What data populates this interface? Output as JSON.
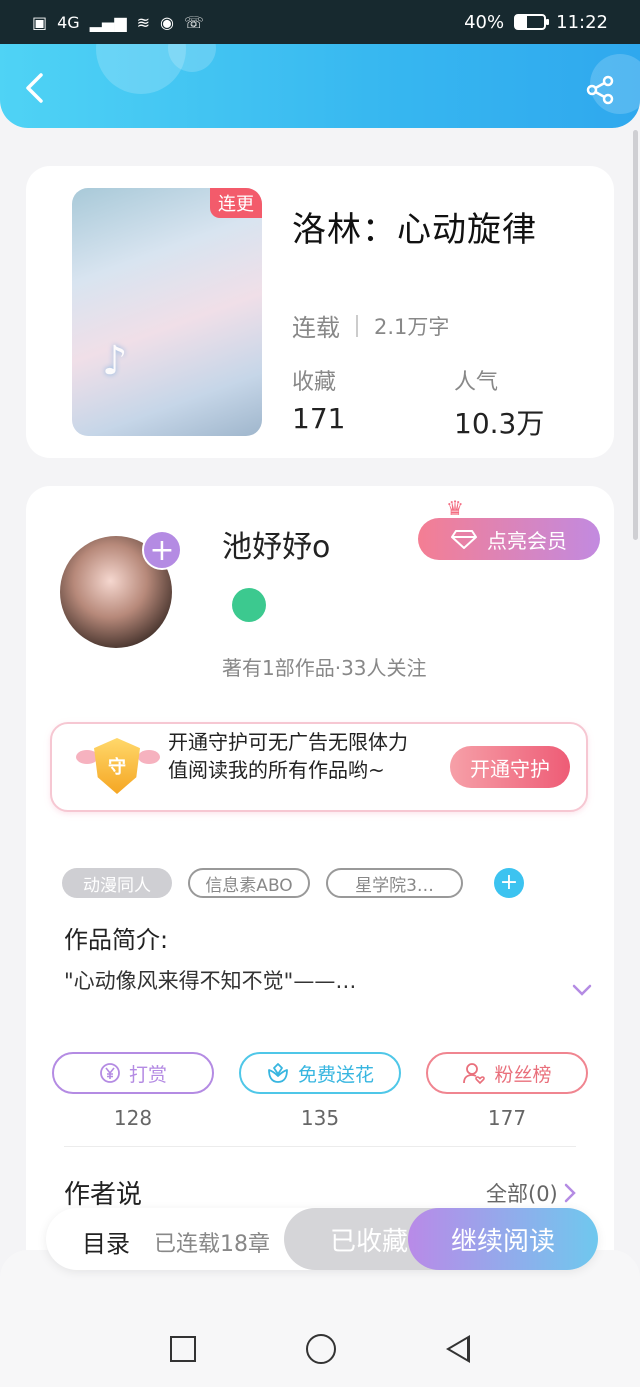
{
  "status_bar": {
    "network": "4G",
    "battery": "40%",
    "battery_level": 0.4,
    "time": "11:22"
  },
  "book": {
    "cover_tag": "连更",
    "title": "洛林：心动旋律",
    "status": "连载",
    "word_count": "2.1万字",
    "favorites_label": "收藏",
    "favorites_value": "171",
    "popularity_label": "人气",
    "popularity_value": "10.3万"
  },
  "author": {
    "name": "池妤妤o",
    "meta": "著有1部作品·33人关注",
    "vip_button": "点亮会员"
  },
  "guard": {
    "shield_text": "守",
    "text": "开通守护可无广告无限体力值阅读我的所有作品哟~",
    "button": "开通守护"
  },
  "tags": [
    "动漫同人",
    "信息素ABO",
    "星学院3…"
  ],
  "intro": {
    "title": "作品简介:",
    "text": "\"心动像风来得不知不觉\"——…"
  },
  "actions": [
    {
      "label": "打赏",
      "count": "128",
      "color": "#b48be3"
    },
    {
      "label": "免费送花",
      "count": "135",
      "color": "#4fc7e8"
    },
    {
      "label": "粉丝榜",
      "count": "177",
      "color": "#f08590"
    }
  ],
  "author_says": {
    "title": "作者说",
    "all_link": "全部(0)"
  },
  "bottom_bar": {
    "toc": "目录",
    "chapters": "已连载18章",
    "collected": "已收藏",
    "continue_reading": "继续阅读"
  },
  "colors": {
    "header": "#37b7f0",
    "accent": "#b48be3"
  }
}
